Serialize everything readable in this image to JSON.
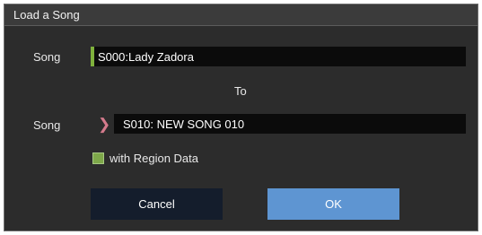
{
  "dialog": {
    "title": "Load a Song",
    "source": {
      "label": "Song",
      "value": "S000:Lady Zadora"
    },
    "to_label": "To",
    "destination": {
      "label": "Song",
      "value": "S010: NEW SONG 010"
    },
    "region_checkbox": {
      "label": "with Region Data",
      "checked": true
    },
    "buttons": {
      "cancel": "Cancel",
      "ok": "OK"
    }
  },
  "colors": {
    "background": "#2c2c2c",
    "field": "#0b0b0b",
    "accent_green": "#7fb13c",
    "arrow_pink": "#d47a8c",
    "ok_blue": "#5e95d2",
    "cancel_dark": "#141d2c"
  },
  "icons": {
    "destination_selector": "chevron-right-icon",
    "accent": "selection-bar"
  }
}
